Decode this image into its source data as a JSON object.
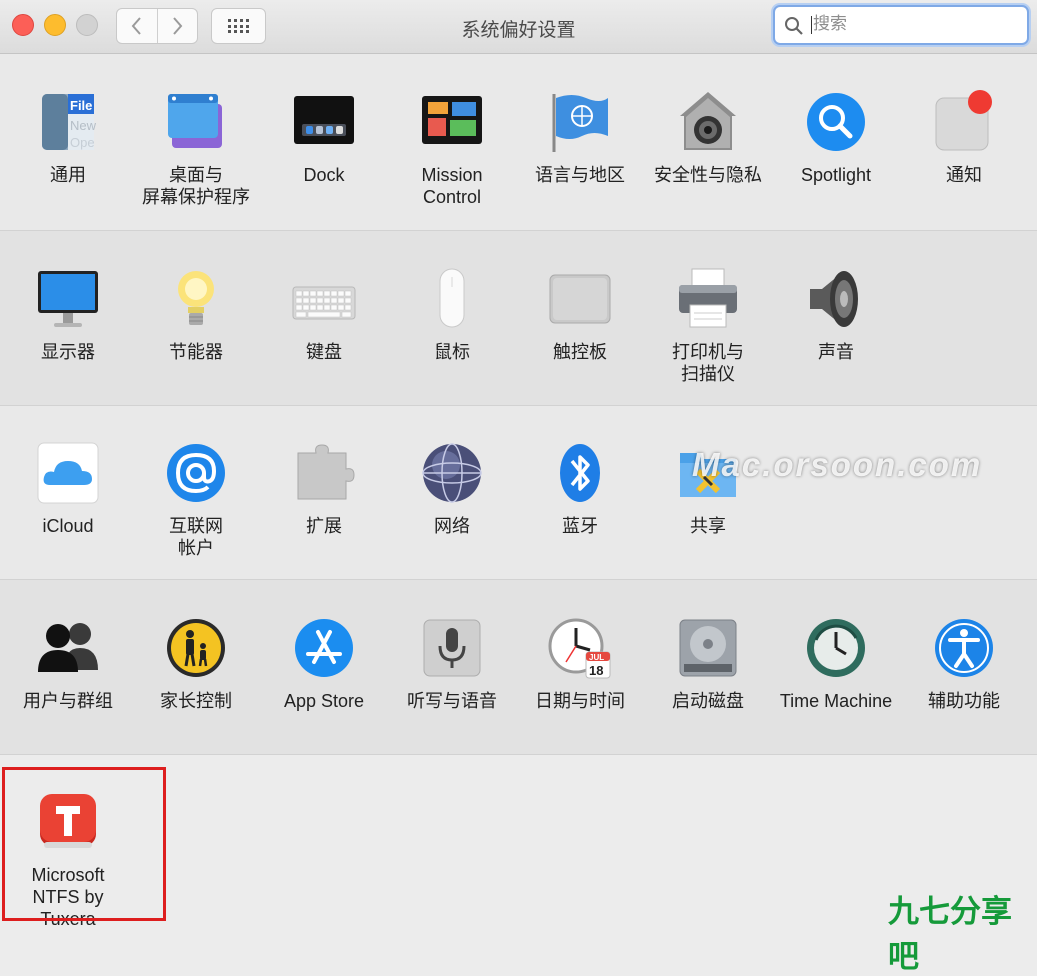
{
  "window": {
    "title": "系统偏好设置"
  },
  "search": {
    "placeholder": "搜索"
  },
  "panes": [
    [
      {
        "label": "通用",
        "icon": "general-icon"
      },
      {
        "label": "桌面与\n屏幕保护程序",
        "icon": "desktop-screensaver-icon"
      },
      {
        "label": "Dock",
        "icon": "dock-icon"
      },
      {
        "label": "Mission\nControl",
        "icon": "mission-control-icon"
      },
      {
        "label": "语言与地区",
        "icon": "language-region-icon"
      },
      {
        "label": "安全性与隐私",
        "icon": "security-privacy-icon"
      },
      {
        "label": "Spotlight",
        "icon": "spotlight-icon"
      },
      {
        "label": "通知",
        "icon": "notifications-icon"
      }
    ],
    [
      {
        "label": "显示器",
        "icon": "displays-icon"
      },
      {
        "label": "节能器",
        "icon": "energy-saver-icon"
      },
      {
        "label": "键盘",
        "icon": "keyboard-icon"
      },
      {
        "label": "鼠标",
        "icon": "mouse-icon"
      },
      {
        "label": "触控板",
        "icon": "trackpad-icon"
      },
      {
        "label": "打印机与\n扫描仪",
        "icon": "printer-scanner-icon"
      },
      {
        "label": "声音",
        "icon": "sound-icon"
      }
    ],
    [
      {
        "label": "iCloud",
        "icon": "icloud-icon"
      },
      {
        "label": "互联网\n帐户",
        "icon": "internet-accounts-icon"
      },
      {
        "label": "扩展",
        "icon": "extensions-icon"
      },
      {
        "label": "网络",
        "icon": "network-icon"
      },
      {
        "label": "蓝牙",
        "icon": "bluetooth-icon"
      },
      {
        "label": "共享",
        "icon": "sharing-icon"
      }
    ],
    [
      {
        "label": "用户与群组",
        "icon": "users-groups-icon"
      },
      {
        "label": "家长控制",
        "icon": "parental-controls-icon"
      },
      {
        "label": "App Store",
        "icon": "app-store-icon"
      },
      {
        "label": "听写与语音",
        "icon": "dictation-speech-icon"
      },
      {
        "label": "日期与时间",
        "icon": "date-time-icon"
      },
      {
        "label": "启动磁盘",
        "icon": "startup-disk-icon"
      },
      {
        "label": "Time Machine",
        "icon": "time-machine-icon"
      },
      {
        "label": "辅助功能",
        "icon": "accessibility-icon"
      }
    ],
    [
      {
        "label": "Microsoft\nNTFS by Tuxera",
        "icon": "tuxera-ntfs-icon"
      }
    ]
  ],
  "icon_text": {
    "general_file": "File",
    "general_new": "New",
    "general_open": "Ope",
    "date_month": "JUL",
    "date_day": "18"
  },
  "watermark": "Mac.orsoon.com",
  "brand": "九七分享吧",
  "colors": {
    "highlight": "#dd1e1e",
    "search_focus": "#7fa9e6",
    "brand": "#159a3a"
  }
}
